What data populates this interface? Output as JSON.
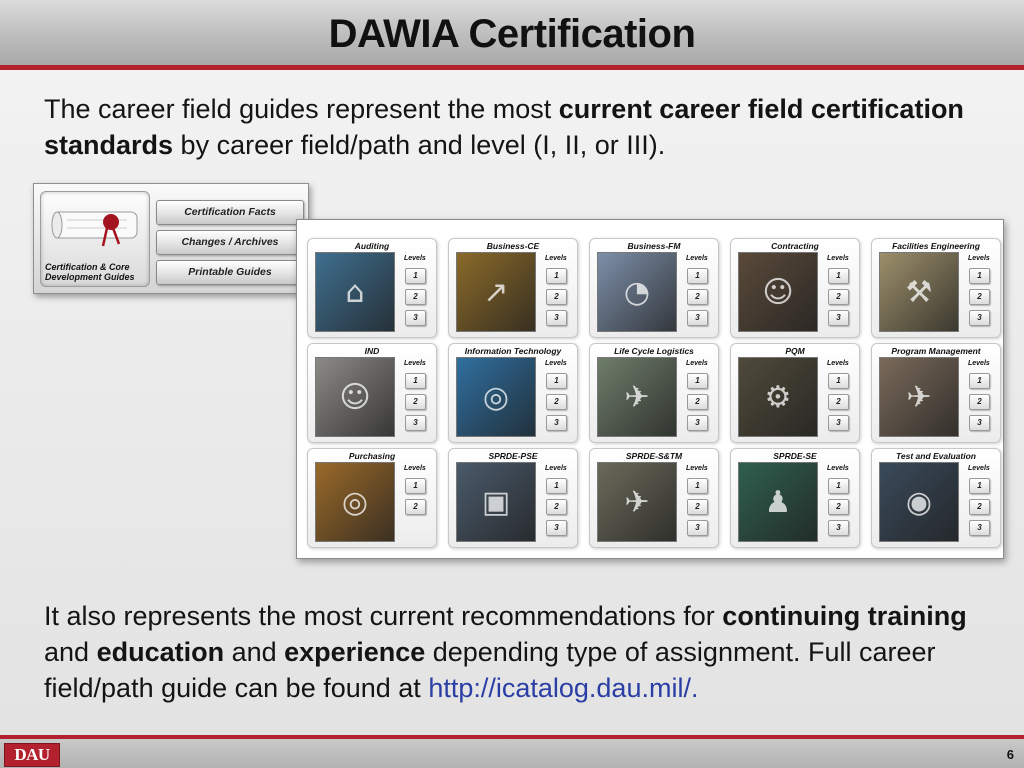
{
  "slide": {
    "title": "DAWIA Certification",
    "page_number": "6",
    "logo_text": "DAU"
  },
  "intro": {
    "t1": "The career field guides represent the most ",
    "b1": "current career field certification standards",
    "t2": " by career field/path and level (I, II, or III)."
  },
  "outro": {
    "t1": "It also represents the most current recommendations for ",
    "b1": "continuing training",
    "t2": " and ",
    "b2": "education",
    "t3": " and ",
    "b3": "experience",
    "t4": " depending type of assignment. Full career field/path guide can be found at ",
    "link": "http://icatalog.dau.mil/."
  },
  "cert_menu": {
    "caption": "Certification & Core Development Guides",
    "buttons": [
      "Certification Facts",
      "Changes / Archives",
      "Printable Guides"
    ]
  },
  "career_fields": {
    "levels_label": "Levels",
    "tiles": [
      {
        "name": "Auditing",
        "levels": [
          "1",
          "2",
          "3"
        ],
        "color": "#3f6f8f",
        "icon": "capitol-building"
      },
      {
        "name": "Business-CE",
        "levels": [
          "1",
          "2",
          "3"
        ],
        "color": "#8a6a2a",
        "icon": "growth-chart"
      },
      {
        "name": "Business-FM",
        "levels": [
          "1",
          "2",
          "3"
        ],
        "color": "#7d8fa8",
        "icon": "pie-chart"
      },
      {
        "name": "Contracting",
        "levels": [
          "1",
          "2",
          "3"
        ],
        "color": "#5a4a3a",
        "icon": "meeting-people"
      },
      {
        "name": "Facilities Engineering",
        "levels": [
          "1",
          "2",
          "3"
        ],
        "color": "#9c8f6a",
        "icon": "engineer-laptop"
      },
      {
        "name": "IND",
        "levels": [
          "1",
          "2",
          "3"
        ],
        "color": "#8c8a86",
        "icon": "team-meeting"
      },
      {
        "name": "Information Technology",
        "levels": [
          "1",
          "2",
          "3"
        ],
        "color": "#2f6f9f",
        "icon": "globe"
      },
      {
        "name": "Life Cycle Logistics",
        "levels": [
          "1",
          "2",
          "3"
        ],
        "color": "#6f7d6a",
        "icon": "military-vehicles"
      },
      {
        "name": "PQM",
        "levels": [
          "1",
          "2",
          "3"
        ],
        "color": "#4f4a3a",
        "icon": "machinery"
      },
      {
        "name": "Program Management",
        "levels": [
          "1",
          "2",
          "3"
        ],
        "color": "#7a6a5a",
        "icon": "helicopter"
      },
      {
        "name": "Purchasing",
        "levels": [
          "1",
          "2"
        ],
        "color": "#9a6a2a",
        "icon": "golden-globe"
      },
      {
        "name": "SPRDE-PSE",
        "levels": [
          "1",
          "2",
          "3"
        ],
        "color": "#4a5a6a",
        "icon": "computer-lab"
      },
      {
        "name": "SPRDE-S&TM",
        "levels": [
          "1",
          "2",
          "3"
        ],
        "color": "#6a6a5a",
        "icon": "drone"
      },
      {
        "name": "SPRDE-SE",
        "levels": [
          "1",
          "2",
          "3"
        ],
        "color": "#2f5f4f",
        "icon": "person-silhouette"
      },
      {
        "name": "Test and Evaluation",
        "levels": [
          "1",
          "2",
          "3"
        ],
        "color": "#3a4a5a",
        "icon": "pilot-helmet"
      }
    ]
  }
}
